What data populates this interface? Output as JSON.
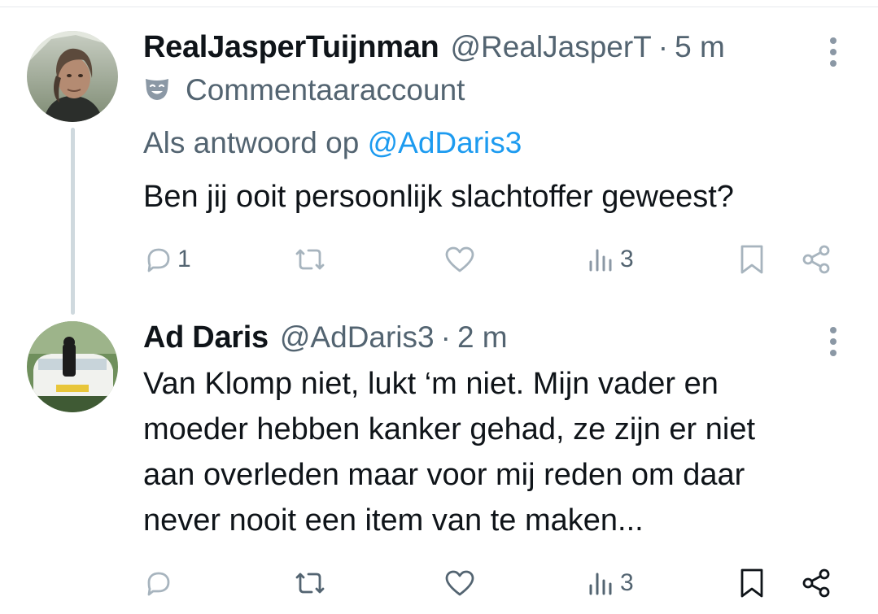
{
  "tweets": [
    {
      "display_name": "RealJasperTuijnman",
      "handle": "@RealJasperT",
      "separator": "·",
      "time": "5 m",
      "label_icon": "comedy-mask-icon",
      "label": "Commentaaraccount",
      "reply_prefix": "Als antwoord op",
      "reply_mention": "@AdDaris3",
      "text": "Ben jij ooit persoonlijk slachtoffer geweest?",
      "actions": {
        "replies": "1",
        "retweets": "",
        "likes": "",
        "views": "3"
      }
    },
    {
      "display_name": "Ad Daris",
      "handle": "@AdDaris3",
      "separator": "·",
      "time": "2 m",
      "text_lines": [
        "Van Klomp niet, lukt ‘m niet. Mijn vader en",
        "moeder hebben kanker gehad, ze zijn er niet",
        "aan overleden maar voor mij reden om daar",
        "never nooit een item van te maken..."
      ],
      "actions": {
        "replies": "",
        "retweets": "",
        "likes": "",
        "views": "3"
      }
    }
  ],
  "colors": {
    "text": "#0f1419",
    "secondary": "#536471",
    "link": "#1d9bf0",
    "icon_light": "#a7b4be",
    "icon_dark": "#536471",
    "thread_line": "#cfd9de"
  }
}
